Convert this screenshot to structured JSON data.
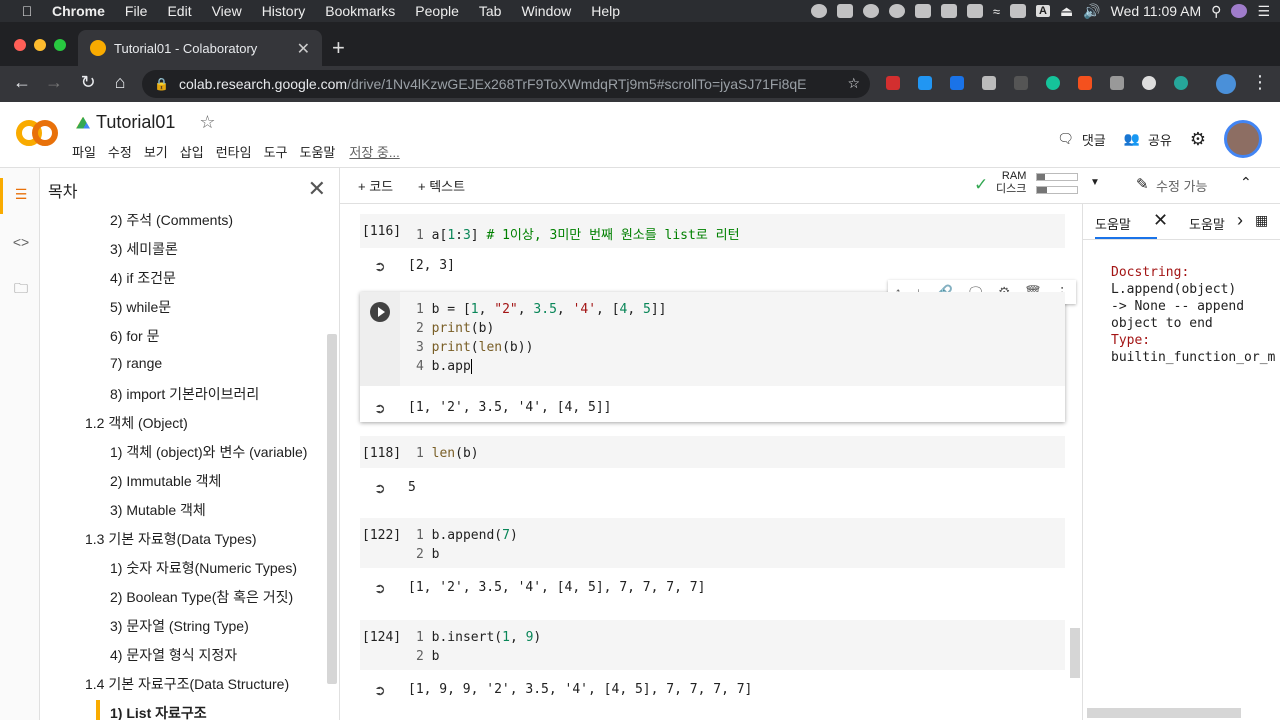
{
  "menubar": {
    "app": "Chrome",
    "items": [
      "File",
      "Edit",
      "View",
      "History",
      "Bookmarks",
      "People",
      "Tab",
      "Window",
      "Help"
    ],
    "clock": "Wed 11:09 AM",
    "input_source": "A"
  },
  "browser": {
    "tab_title": "Tutorial01 - Colaboratory",
    "url_host": "colab.research.google.com",
    "url_path": "/drive/1Nv4lKzwGEJEx268TrF9ToXWmdqRTj9m5#scrollTo=jyaSJ71Fi8qE"
  },
  "colab": {
    "title": "Tutorial01",
    "menus": [
      "파일",
      "수정",
      "보기",
      "삽입",
      "런타임",
      "도구",
      "도움말"
    ],
    "saving": "저장 중...",
    "comment": "댓글",
    "share": "공유"
  },
  "toc": {
    "title": "목차",
    "items": [
      {
        "label": "2) 주석 (Comments)",
        "level": 2
      },
      {
        "label": "3) 세미콜론",
        "level": 2
      },
      {
        "label": "4) if 조건문",
        "level": 2
      },
      {
        "label": "5) while문",
        "level": 2
      },
      {
        "label": "6) for 문",
        "level": 2
      },
      {
        "label": "7) range",
        "level": 2
      },
      {
        "label": "8) import 기본라이브러리",
        "level": 2
      },
      {
        "label": "1.2 객체 (Object)",
        "level": 1
      },
      {
        "label": "1) 객체 (object)와 변수 (variable)",
        "level": 2
      },
      {
        "label": "2) Immutable 객체",
        "level": 2
      },
      {
        "label": "3) Mutable 객체",
        "level": 2
      },
      {
        "label": "1.3 기본 자료형(Data Types)",
        "level": 1
      },
      {
        "label": "1) 숫자 자료형(Numeric Types)",
        "level": 2
      },
      {
        "label": "2) Boolean Type(참 혹은 거짓)",
        "level": 2
      },
      {
        "label": "3) 문자열 (String Type)",
        "level": 2
      },
      {
        "label": "4) 문자열 형식 지정자",
        "level": 2
      },
      {
        "label": "1.4 기본 자료구조(Data Structure)",
        "level": 1
      },
      {
        "label": "1) List 자료구조",
        "level": 2
      }
    ]
  },
  "notebook_toolbar": {
    "add_code": "+ 코드",
    "add_text": "+ 텍스트",
    "ram": "RAM",
    "disk": "디스크",
    "edit_mode": "수정 가능"
  },
  "cells": [
    {
      "exec": "[116]",
      "lines": [
        "a[1:3] # 1이상, 3미만 번째 원소를 list로 리턴"
      ],
      "output": "[2, 3]"
    },
    {
      "exec": "",
      "lines": [
        "b = [1, \"2\", 3.5, '4', [4, 5]]",
        "print(b)",
        "print(len(b))",
        "b.app"
      ],
      "output": "[1, '2', 3.5, '4', [4, 5]]"
    },
    {
      "exec": "[118]",
      "lines": [
        "len(b)"
      ],
      "output": "5"
    },
    {
      "exec": "[122]",
      "lines": [
        "b.append(7)",
        "b"
      ],
      "output": "[1, '2', 3.5, '4', [4, 5], 7, 7, 7, 7]"
    },
    {
      "exec": "[124]",
      "lines": [
        "b.insert(1, 9)",
        "b"
      ],
      "output": "[1, 9, 9, '2', 3.5, '4', [4, 5], 7, 7, 7, 7]"
    }
  ],
  "help": {
    "tab1": "도움말",
    "tab2": "도움말",
    "docstring_label": "Docstring:",
    "docstring": "L.append(object)\n-> None -- append\nobject to end",
    "type_label": "Type:",
    "type_value": "builtin_function_or_m"
  }
}
